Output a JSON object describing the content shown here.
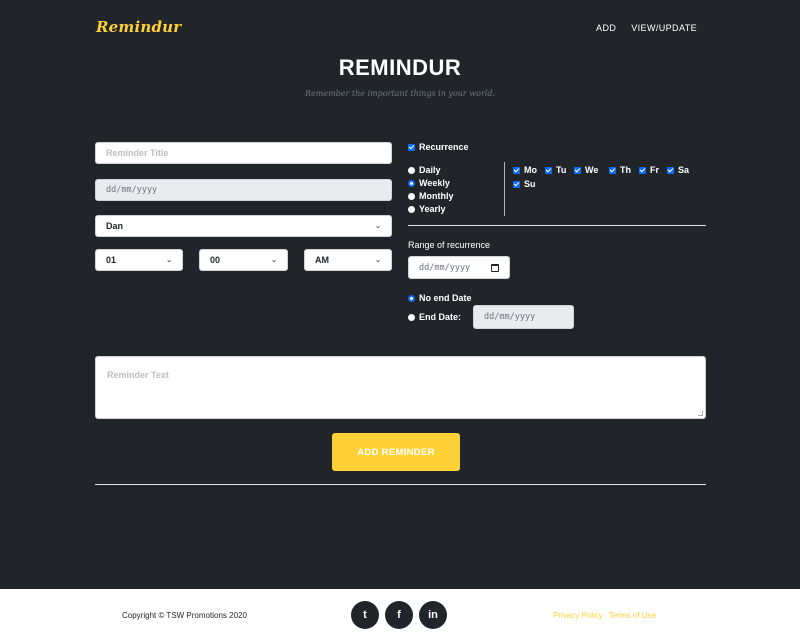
{
  "nav": {
    "brand": "Remindur",
    "add": "ADD",
    "view_update": "VIEW/UPDATE"
  },
  "header": {
    "title": "REMINDUR",
    "subtitle": "Remember the important things in your world."
  },
  "form": {
    "title_placeholder": "Reminder Title",
    "date_placeholder": "dd/mm/yyyy",
    "person_value": "Dan",
    "hour_value": "01",
    "minute_value": "00",
    "ampm_value": "AM",
    "text_placeholder": "Reminder Text",
    "submit_label": "ADD REMINDER"
  },
  "recurrence": {
    "label": "Recurrence",
    "checked": true,
    "frequencies": [
      {
        "label": "Daily",
        "selected": false
      },
      {
        "label": "Weekly",
        "selected": true
      },
      {
        "label": "Monthly",
        "selected": false
      },
      {
        "label": "Yearly",
        "selected": false
      }
    ],
    "days": [
      {
        "label": "Mo",
        "checked": true
      },
      {
        "label": "Tu",
        "checked": true
      },
      {
        "label": "We",
        "checked": true
      },
      {
        "label": "Th",
        "checked": true
      },
      {
        "label": "Fr",
        "checked": true
      },
      {
        "label": "Sa",
        "checked": true
      },
      {
        "label": "Su",
        "checked": true
      }
    ],
    "range_label": "Range of recurrence",
    "range_start_placeholder": "dd/mm/yyyy",
    "no_end_label": "No end Date",
    "end_date_label": "End Date:",
    "end_date_placeholder": "dd/mm/yyyy"
  },
  "footer": {
    "copyright": "Copyright © TSW Promotions 2020",
    "social": [
      {
        "icon": "twitter-icon",
        "glyph": "t"
      },
      {
        "icon": "facebook-icon",
        "glyph": "f"
      },
      {
        "icon": "linkedin-icon",
        "glyph": "in"
      }
    ],
    "privacy": "Privacy Policy",
    "terms": "Terms of Use"
  },
  "colors": {
    "background": "#212529",
    "accent": "#fed136",
    "checkbox": "#0d6efd"
  }
}
